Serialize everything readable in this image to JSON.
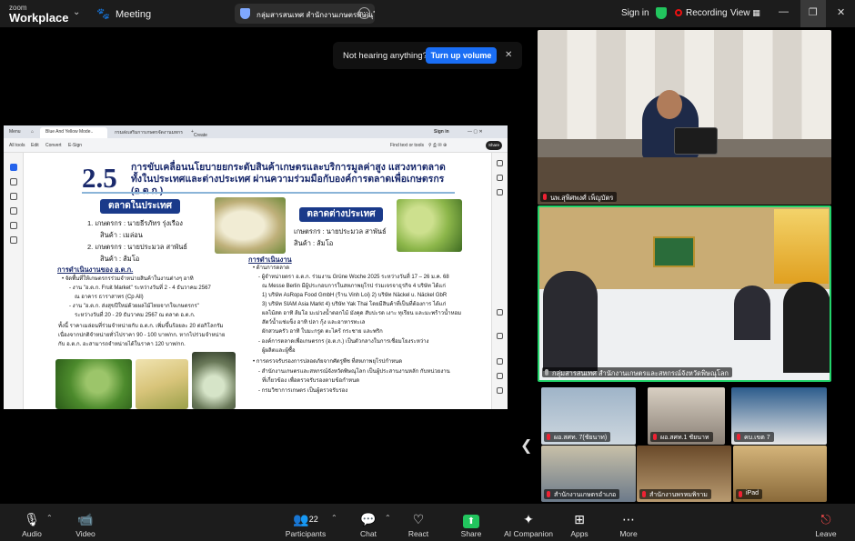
{
  "app": {
    "brand_small": "zoom",
    "brand_big": "Workplace",
    "meeting_label": "Meeting"
  },
  "meeting_title": "กลุ่มสารสนเทศ สำนักงานเกษตรพิษณุโลก",
  "header": {
    "signin": "Sign in",
    "recording": "Recording",
    "view": "View"
  },
  "notification": {
    "text": "Not hearing anything?",
    "button": "Turn up volume"
  },
  "shared_screen": {
    "tab_menu": "Menu",
    "tab_active": "Blue And Yellow Mode..",
    "tab_second": "กรมส่งเสริมการเกษตรจัดงานมหกรรม..",
    "tab_create": "Create",
    "browser_signin": "Sign in",
    "tools": [
      "All tools",
      "Edit",
      "Convert",
      "E-Sign"
    ],
    "find_text": "Find text or tools",
    "share_btn": "Share",
    "slide": {
      "number": "2.5",
      "title_line1": "การขับเคลื่อนนโยบายยกระดับสินค้าเกษตรและบริการมูลค่าสูง แสวงหาตลาด",
      "title_line2": "ทั้งในประเทศและต่างประเทศ ผ่านความร่วมมือกับองค์การตลาดเพื่อเกษตรกร (อ.ต.ก.)",
      "domestic_label": "ตลาดในประเทศ",
      "foreign_label": "ตลาดต่างประเทศ",
      "domestic_farmers": [
        "1. เกษตรกร : นายธีรภัทร รุ่งเรือง",
        "สินค้า : เมล่อน",
        "2. เกษตรกร : นายประมวล สาพันธ์",
        "สินค้า : ส้มโอ"
      ],
      "foreign_farmers": [
        "เกษตรกร : นายประมวล สาพันธ์",
        "สินค้า : ส้มโอ"
      ],
      "left_heading": "การดำเนินงานของ อ.ต.ก.",
      "left_lines": [
        "• จัดพื้นที่ให้เกษตรกรร่วมจำหน่ายสินค้าในงานต่างๆ อาทิ",
        "- งาน \"อ.ต.ก. Fruit Market\" ระหว่างวันที่ 2 - 4 ธันวาคม 2567",
        "ณ อาคาร ธาราสาทร (Cp All)",
        "- งาน \"อ.ต.ก. ส่งสุขปีใหม่ด้วยผลไม้ไทยจากใจเกษตรกร\"",
        "ระหว่างวันที่ 20 - 29 ธันวาคม 2567 ณ ตลาด อ.ต.ก.",
        "ทั้งนี้ ราคาเมล่อนที่ร่วมจำหน่ายกับ อ.ต.ก. เพิ่มขึ้นร้อยละ 20 ต่อกิโลกรัม",
        "เนื่องจากปกติจำหน่ายทั่วไปราคา 90 - 100 บาท/กก. หากไปร่วมจำหน่าย",
        "กับ อ.ต.ก. อะสามารถจำหน่ายได้ในราคา 120 บาท/กก."
      ],
      "right_heading": "การดำเนินงาน",
      "right_lines": [
        "• ด้านการตลาด",
        "- ผู้จำหน่ายตรา อ.ต.ก. ร่วมงาน Grüne Woche 2025 ระหว่างวันที่ 17 – 26 ม.ค. 68",
        "ณ Messe Berlin มีผู้ประกอบการในสหภาพยุโรป ร่วมเจรจาธุรกิจ 4 บริษัท ได้แก่",
        "1) บริษัท AsRopa Food GmbH (ร้าน Vinh Loi) 2) บริษัท Näckel u. Näckel GbR",
        "3) บริษัท SIAM Asia Markt 4) บริษัท Yak Thai โดยมีสินค้าที่เป็นที่ต้องการ ได้แก่",
        "ผลไม้สด อาทิ ส้มโอ มะม่วงน้ำดอกไม้ มังคุด สับปะรด เงาะ ทุเรียน และมะพร้าวน้ำหอม",
        "สัตว์น้ำแช่แข็ง อาทิ ปลา กุ้ง และอาหารทะเล",
        "ผักสวนครัว อาทิ ใบมะกรูด ตะไคร้ กระชาย และพริก",
        "- องค์การตลาดเพื่อเกษตรกร (อ.ต.ก.) เป็นตัวกลางในการเชื่อมโยงระหว่าง",
        "ผู้ผลิตและผู้ซื้อ",
        "• การตรวจรับรองการปลอดภัยจากศัตรูพืช ที่สหภาพยุโรปกำหนด",
        "- สำนักงานเกษตรและสหกรณ์จังหวัดพิษณุโลก เป็นผู้ประสานงานหลัก กับหน่วยงาน",
        "ที่เกี่ยวข้อง เพื่อตรวจรับรองตามข้อกำหนด",
        "- กรมวิชาการเกษตร เป็นผู้ตรวจรับรอง"
      ]
    }
  },
  "participants_tiles": [
    {
      "name": "นพ.สุพิศพงศ์ เพ็ญบัตร"
    },
    {
      "name": "กลุ่มสารสนเทศ สำนักงานเกษตรและสหกรณ์จังหวัดพิษณุโลก"
    },
    {
      "name": "ผอ.สศท. 7(ชัยนาท)"
    },
    {
      "name": "ผอ.สศท.1 ชัยนาท"
    },
    {
      "name": "คบ.เขต 7"
    },
    {
      "name": "สำนักงานเกษตรอำเภอ"
    },
    {
      "name": "สำนักงานพรหมพิราม"
    },
    {
      "name": "iPad"
    }
  ],
  "toolbar": {
    "audio": "Audio",
    "video": "Video",
    "participants": "Participants",
    "participants_count": "22",
    "chat": "Chat",
    "react": "React",
    "share": "Share",
    "ai": "AI Companion",
    "apps": "Apps",
    "more": "More",
    "leave": "Leave"
  },
  "colors": {
    "accent_blue": "#1a6ef5",
    "share_green": "#22c55e",
    "active_speaker": "#22d36a",
    "slide_navy": "#1a2a6c"
  }
}
